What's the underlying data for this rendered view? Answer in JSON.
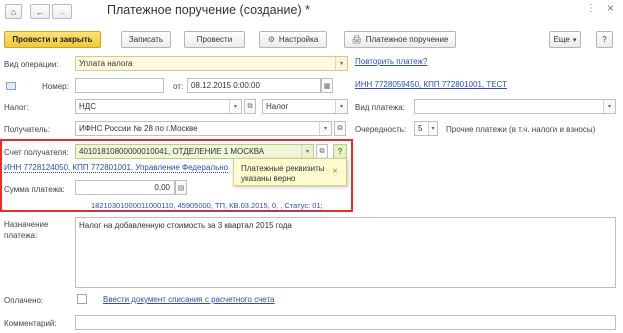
{
  "header": {
    "title": "Платежное поручение (создание) *",
    "home_icon": "⌂",
    "back_icon": "←",
    "forward_icon": "→",
    "more_icon": "⋮",
    "close_icon": "×"
  },
  "toolbar": {
    "post_close": "Провести и закрыть",
    "save": "Записать",
    "post": "Провести",
    "settings": "Настройка",
    "settings_icon": "⚙",
    "print": "Платежное поручение",
    "print_icon": "🖨",
    "more": "Еще",
    "more_arrow": "▾",
    "help": "?"
  },
  "form": {
    "operation_label": "Вид операции:",
    "operation_value": "Уплата налога",
    "repeat_link": "Повторить платеж?",
    "number_label": "Номер:",
    "number_value": "",
    "from_label": "от:",
    "date_value": "08.12.2015  0:00:00",
    "org_link": "ИНН 7728059450, КПП 772801001, ТЕСТ",
    "tax_label": "Налог:",
    "tax_value": "НДС",
    "tax_kind_value": "Налог",
    "payment_kind_label": "Вид платежа:",
    "payment_kind_value": "",
    "recipient_label": "Получатель:",
    "recipient_value": "ИФНС России № 28 по г.Москве",
    "priority_label": "Очередность:",
    "priority_value": "5",
    "priority_text": "Прочие платежи (в т.ч. налоги и взносы)",
    "account_label": "Счет получателя:",
    "account_value": "40101810800000010041, ОТДЕЛЕНИЕ 1 МОСКВА",
    "recipient_details_link": "ИНН 7728124050, КПП 772801001, Управление Федерально",
    "amount_label": "Сумма платежа:",
    "amount_value": "0,00",
    "budget_details_link": "18210301000011000110, 45905000, ТП, КВ.03.2015, 0, , Статус: 01;",
    "purpose_label": "Назначение платежа:",
    "purpose_value": "Налог на добавленную стоимость за 3 квартал 2015 года",
    "paid_label": "Оплачено:",
    "writeoff_link": "Ввести документ списания с расчетного счета",
    "comment_label": "Комментарий:",
    "comment_value": ""
  },
  "tooltip": {
    "text_line1": "Платежные реквизиты",
    "text_line2": "указаны верно",
    "close": "×"
  },
  "colors": {
    "highlight_border": "#e03030",
    "primary_button": "#f2c935",
    "tooltip_bg": "#fdfbd0",
    "link": "#2a4fb0"
  }
}
